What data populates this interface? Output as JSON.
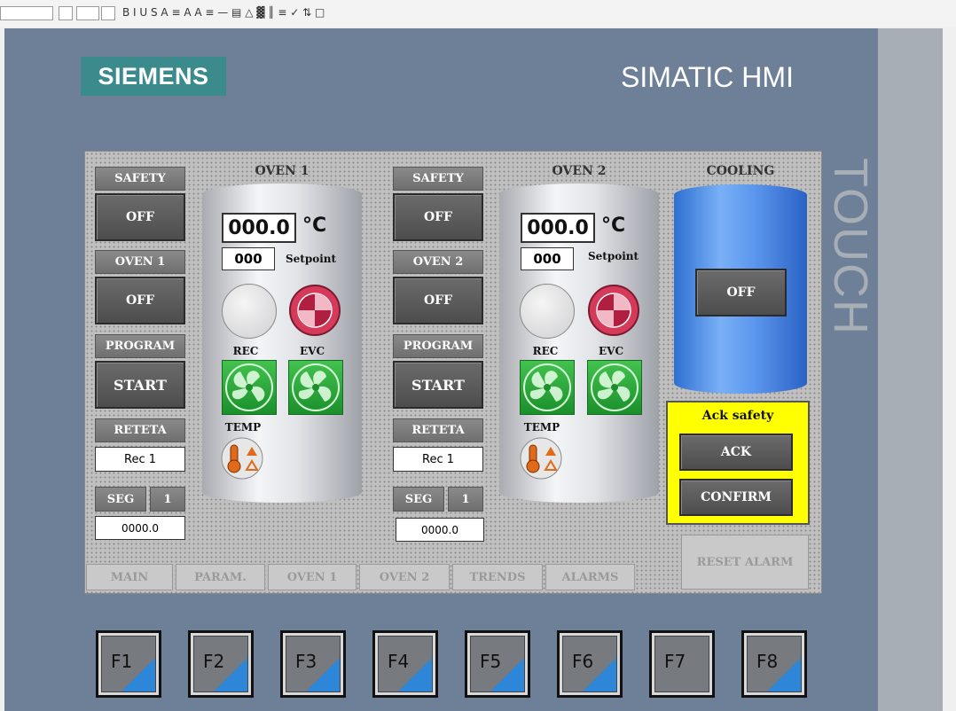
{
  "toolbar": {
    "glyphs": "B  I  U  S  A  ≡  A  A  ≡  —  ▤  △  ▓  ║  ≡  ✓  ⇅  □"
  },
  "header": {
    "brand": "SIEMENS",
    "product": "SIMATIC HMI",
    "side_label": "TOUCH"
  },
  "oven1": {
    "title": "OVEN 1",
    "safety_label": "SAFETY",
    "safety_btn": "OFF",
    "oven_label": "OVEN 1",
    "oven_btn": "OFF",
    "program_label": "PROGRAM",
    "program_btn": "START",
    "recipe_label": "RETETA",
    "recipe_value": "Rec 1",
    "seg_label": "SEG",
    "seg_num": "1",
    "seg_value": "0000.0",
    "temp_value": "000.0",
    "temp_unit": "°C",
    "setpoint_value": "000",
    "setpoint_label": "Setpoint",
    "rec_label": "REC",
    "evc_label": "EVC",
    "temp_label": "TEMP"
  },
  "oven2": {
    "title": "OVEN 2",
    "safety_label": "SAFETY",
    "safety_btn": "OFF",
    "oven_label": "OVEN 2",
    "oven_btn": "OFF",
    "program_label": "PROGRAM",
    "program_btn": "START",
    "recipe_label": "RETETA",
    "recipe_value": "Rec 1",
    "seg_label": "SEG",
    "seg_num": "1",
    "seg_value": "0000.0",
    "temp_value": "000.0",
    "temp_unit": "°C",
    "setpoint_value": "000",
    "setpoint_label": "Setpoint",
    "rec_label": "REC",
    "evc_label": "EVC",
    "temp_label": "TEMP"
  },
  "cooling": {
    "title": "COOLING",
    "btn": "OFF"
  },
  "ack_box": {
    "title": "Ack safety",
    "ack": "ACK",
    "confirm": "CONFIRM"
  },
  "reset_alarm": "RESET ALARM",
  "tabs": [
    "MAIN",
    "PARAM.",
    "OVEN 1",
    "OVEN 2",
    "TRENDS",
    "ALARMS"
  ],
  "function_keys": [
    "F1",
    "F2",
    "F3",
    "F4",
    "F5",
    "F6",
    "F7",
    "F8"
  ],
  "colors": {
    "panel": "#6d8098",
    "siemens_teal": "#3b8a8c",
    "ack_yellow": "#ffff00",
    "cooling_blue": "#4a8ae8",
    "fkey_corner": "#2e86d8",
    "fan_green": "#2fa83c"
  }
}
